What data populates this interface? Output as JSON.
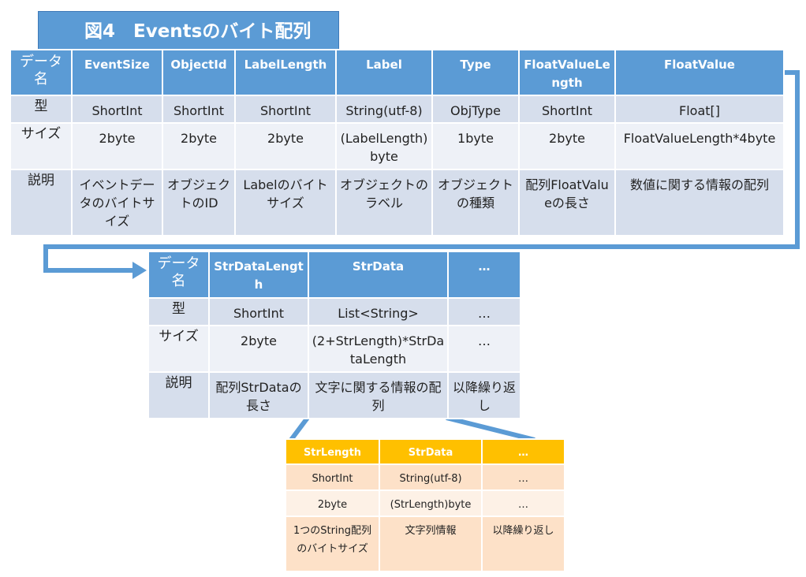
{
  "title": "図4　Eventsのバイト配列",
  "table1": {
    "row_labels": [
      "データ名",
      "型",
      "サイズ",
      "説明"
    ],
    "columns": [
      {
        "name": "EventSize",
        "type": "ShortInt",
        "size": "2byte",
        "desc": "イベントデータのバイトサイズ"
      },
      {
        "name": "ObjectId",
        "type": "ShortInt",
        "size": "2byte",
        "desc": "オブジェクトのID"
      },
      {
        "name": "LabelLength",
        "type": "ShortInt",
        "size": "2byte",
        "desc": "Labelのバイトサイズ"
      },
      {
        "name": "Label",
        "type": "String(utf-8)",
        "size": "(LabelLength)byte",
        "desc": "オブジェクトのラベル"
      },
      {
        "name": "Type",
        "type": "ObjType",
        "size": "1byte",
        "desc": "オブジェクトの種類"
      },
      {
        "name": "FloatValueLength",
        "type": "ShortInt",
        "size": "2byte",
        "desc": "配列FloatValueの長さ"
      },
      {
        "name": "FloatValue",
        "type": "Float[]",
        "size": "FloatValueLength*4byte",
        "desc": "数値に関する情報の配列"
      }
    ]
  },
  "table2": {
    "row_labels": [
      "データ名",
      "型",
      "サイズ",
      "説明"
    ],
    "columns": [
      {
        "name": "StrDataLength",
        "type": "ShortInt",
        "size": "2byte",
        "desc": "配列StrDataの長さ"
      },
      {
        "name": "StrData",
        "type": "List<String>",
        "size": "(2+StrLength)*StrDataLength",
        "desc": "文字に関する情報の配列"
      },
      {
        "name": "…",
        "type": "…",
        "size": "…",
        "desc": "以降繰り返し"
      }
    ]
  },
  "table3": {
    "columns": [
      {
        "name": "StrLength",
        "type": "ShortInt",
        "size": "2byte",
        "desc": "1つのString配列のバイトサイズ"
      },
      {
        "name": "StrData",
        "type": "String(utf-8)",
        "size": "(StrLength)byte",
        "desc": "文字列情報"
      },
      {
        "name": "…",
        "type": "…",
        "size": "…",
        "desc": "以降繰り返し"
      }
    ]
  },
  "colors": {
    "header_blue": "#5b9bd5",
    "row_blue_dark": "#d6deec",
    "row_blue_light": "#eef1f7",
    "header_orange": "#ffc000",
    "row_orange_dark": "#fde1c8",
    "row_orange_light": "#fdf1e6"
  }
}
